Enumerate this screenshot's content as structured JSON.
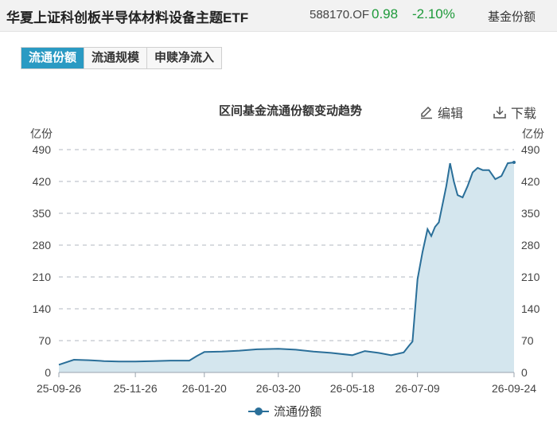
{
  "header": {
    "fund_name": "华夏上证科创板半导体材料设备主题ETF",
    "fund_code": "588170.OF",
    "price": "0.98",
    "change": "-2.10%",
    "section_label": "基金份额"
  },
  "tabs": [
    {
      "label": "流通份额",
      "active": true
    },
    {
      "label": "流通规模",
      "active": false
    },
    {
      "label": "申赎净流入",
      "active": false
    }
  ],
  "toolbar": {
    "edit_label": "编辑",
    "download_label": "下载"
  },
  "colors": {
    "accent": "#2a9ac3",
    "line": "#2a6f99",
    "area": "#d4e6ee",
    "grid": "#b0b7c0",
    "down": "#1e9a3a"
  },
  "chart_data": {
    "type": "area",
    "title": "区间基金流通份额变动趋势",
    "ylabel": "亿份",
    "ylabel_right": "亿份",
    "ylim": [
      0,
      490
    ],
    "yticks": [
      0,
      70,
      140,
      210,
      280,
      350,
      420,
      490
    ],
    "xticks": [
      "25-09-26",
      "25-11-26",
      "26-01-20",
      "26-03-20",
      "26-05-18",
      "26-07-09",
      "26-09-24"
    ],
    "grid": true,
    "legend": "bottom-center",
    "series": [
      {
        "name": "流通份额",
        "x": [
          "25-09-26",
          "25-10-08",
          "25-10-20",
          "25-11-01",
          "25-11-13",
          "25-11-26",
          "25-12-10",
          "25-12-24",
          "26-01-08",
          "26-01-14",
          "26-01-20",
          "26-02-03",
          "26-02-17",
          "26-03-03",
          "26-03-20",
          "26-04-03",
          "26-04-17",
          "26-05-01",
          "26-05-18",
          "26-05-28",
          "26-06-08",
          "26-06-18",
          "26-06-28",
          "26-07-02",
          "26-07-05",
          "26-07-09",
          "26-07-13",
          "26-07-17",
          "26-07-20",
          "26-07-23",
          "26-07-26",
          "26-07-29",
          "26-08-01",
          "26-08-04",
          "26-08-07",
          "26-08-10",
          "26-08-14",
          "26-08-18",
          "26-08-22",
          "26-08-26",
          "26-08-30",
          "26-09-04",
          "26-09-09",
          "26-09-14",
          "26-09-19",
          "26-09-24"
        ],
        "values": [
          17,
          28,
          27,
          25,
          24,
          24,
          25,
          26,
          26,
          36,
          45,
          46,
          48,
          51,
          52,
          50,
          46,
          43,
          38,
          47,
          43,
          38,
          44,
          58,
          68,
          205,
          265,
          315,
          300,
          320,
          330,
          370,
          410,
          460,
          420,
          390,
          385,
          410,
          440,
          450,
          445,
          445,
          425,
          432,
          460,
          462
        ]
      }
    ]
  }
}
